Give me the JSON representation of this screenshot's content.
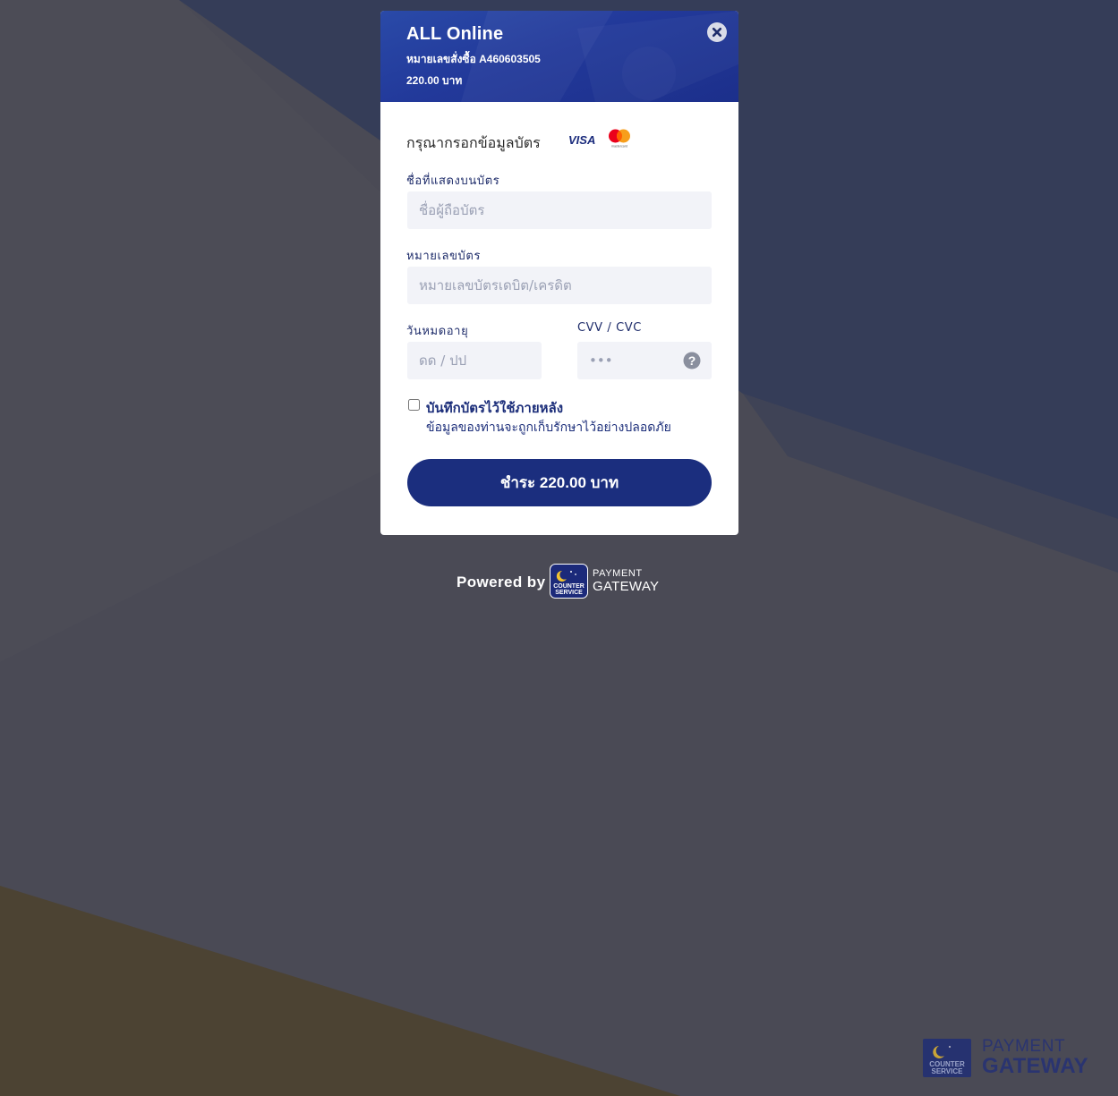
{
  "header": {
    "merchant_name": "ALL Online",
    "order_line": "หมายเลขสั่งซื้อ A460603505",
    "amount_line": "220.00 บาท"
  },
  "form": {
    "title": "กรุณากรอกข้อมูลบัตร",
    "card_brands": [
      "VISA",
      "mastercard"
    ],
    "name_label": "ชื่อที่แสดงบนบัตร",
    "name_placeholder": "ชื่อผู้ถือบัตร",
    "number_label": "หมายเลขบัตร",
    "number_placeholder": "หมายเลขบัตรเดบิต/เครดิต",
    "expiry_label": "วันหมดอายุ",
    "expiry_placeholder": "ดด / ปป",
    "cvv_label": "CVV / CVC",
    "cvv_placeholder": "•••",
    "save_card_title": "บันทึกบัตรไว้ใช้ภายหลัง",
    "save_card_subtitle": "ข้อมูลของท่านจะถูกเก็บรักษาไว้อย่างปลอดภัย",
    "pay_button": "ชำระ 220.00 บาท"
  },
  "footer": {
    "powered_by": "Powered by",
    "gateway_top": "PAYMENT",
    "gateway_bottom": "GATEWAY",
    "brand_line1": "COUNTER",
    "brand_line2": "SERVICE"
  },
  "watermark": {
    "top": "PAYMENT",
    "bottom": "GATEWAY"
  },
  "colors": {
    "accent": "#1b2e7e",
    "header": "#22399a",
    "background": "#4a4a55"
  },
  "icons": {
    "close": "close-icon",
    "help": "help-icon"
  }
}
